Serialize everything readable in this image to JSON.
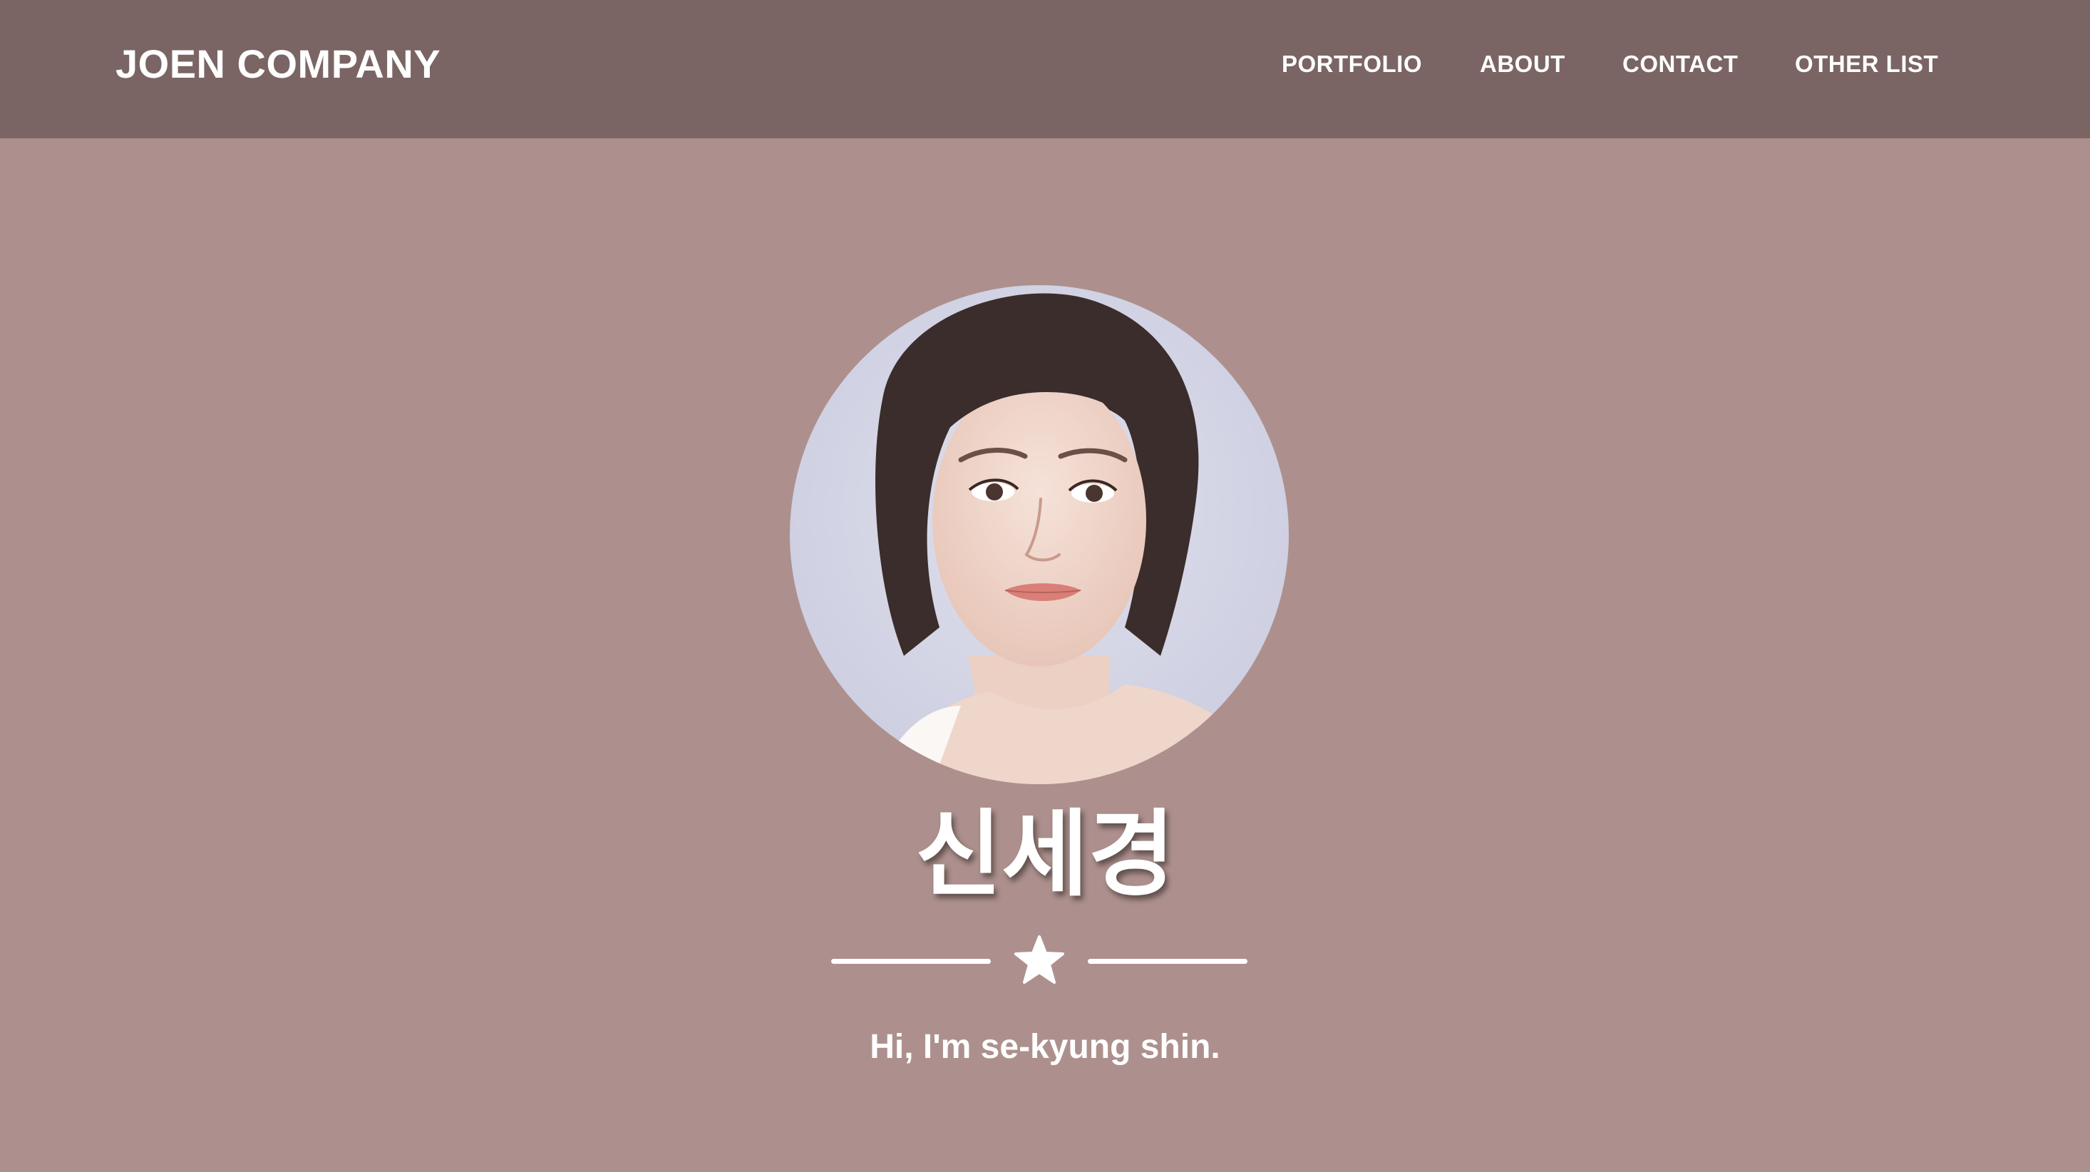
{
  "header": {
    "brand": "JOEN COMPANY",
    "nav": {
      "portfolio": "PORTFOLIO",
      "about": "ABOUT",
      "contact": "CONTACT",
      "other_list": "OTHER LIST"
    }
  },
  "hero": {
    "name": "신세경",
    "divider_icon": "star-icon",
    "tagline": "Hi, I'm se-kyung shin."
  },
  "colors": {
    "header_bg": "#7a6564",
    "page_bg": "#ad908d",
    "text": "#ffffff"
  }
}
